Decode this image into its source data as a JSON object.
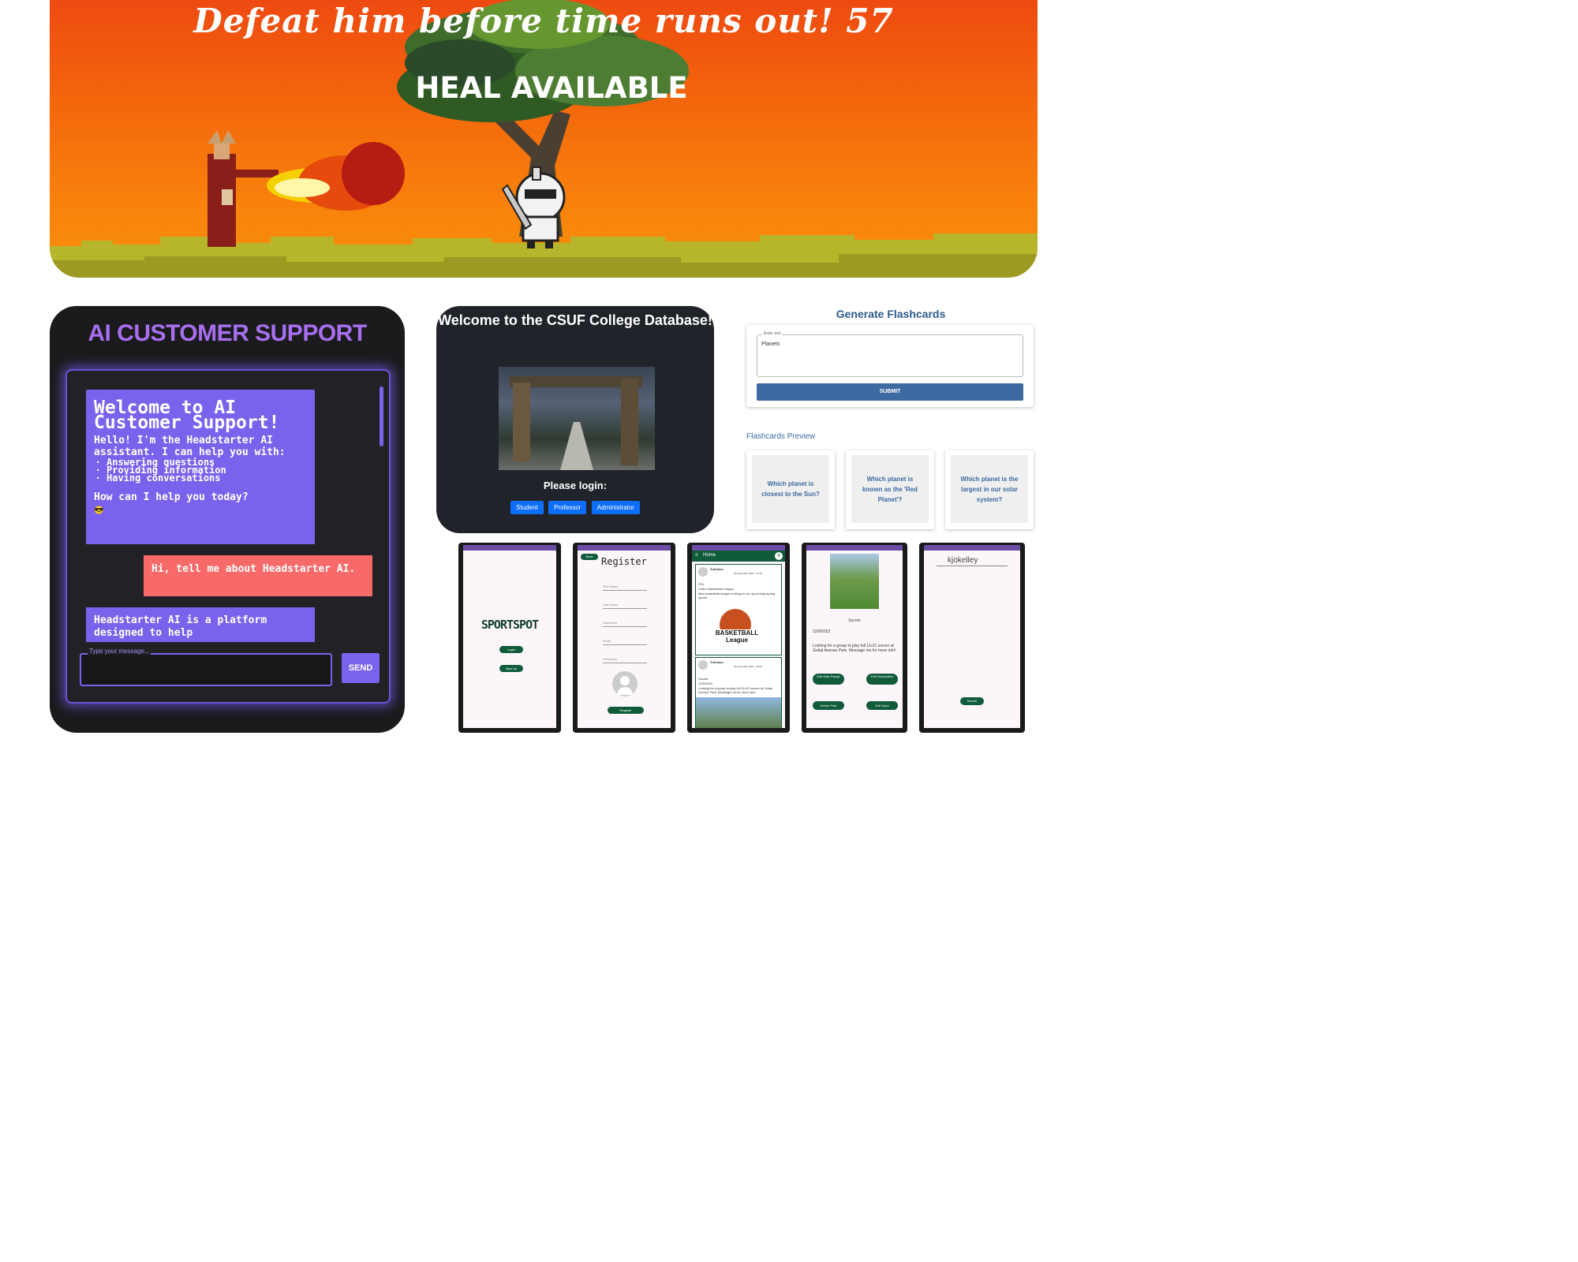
{
  "game": {
    "title": "Defeat him before time runs out! 57",
    "status": "HEAL AVAILABLE"
  },
  "ai_support": {
    "title": "AI CUSTOMER SUPPORT",
    "welcome_heading": "Welcome to AI Customer Support!",
    "welcome_text": "Hello! I'm the Headstarter AI assistant. I can help you with:",
    "capabilities": [
      "Answering questions",
      "Providing information",
      "Having conversations"
    ],
    "welcome_question": "How can I help you today?",
    "welcome_emoji": "😎",
    "user_message": "Hi, tell me about Headstarter AI.",
    "bot_reply": "Headstarter AI is a platform designed to help",
    "input_placeholder": "Type your message...",
    "send_label": "SEND"
  },
  "csuf": {
    "title": "Welcome to the CSUF College Database!",
    "login_prompt": "Please login:",
    "buttons": [
      "Student",
      "Professor",
      "Administrator"
    ]
  },
  "flashcards": {
    "title": "Generate Flashcards",
    "input_label": "Enter text",
    "input_value": "Planets",
    "submit_label": "SUBMIT",
    "preview_label": "Flashcards Preview",
    "cards": [
      "Which planet is closest to the Sun?",
      "Which planet is known as the 'Red Planet'?",
      "Which planet is the largest in our solar system?"
    ]
  },
  "sportspot": {
    "logo": "SPORTSPOT",
    "login": "Login",
    "signup": "Sign Up",
    "back": "Back",
    "register_title": "Register",
    "register_fields": [
      "First Name",
      "Last Name",
      "Username",
      "Email",
      "Password"
    ],
    "register_button": "Register",
    "home_title": "Home",
    "post1_user": "Zohhaos",
    "post1_date": "22 December 2023 · 17:15",
    "post1_sport": "CSL",
    "post1_title": "Club's Basketball League",
    "post1_text": "New basketball league looking for an up-coming spring sports",
    "basketball_logo": "BASKETBALL League",
    "post2_user": "Zohhaos",
    "post2_date": "24 December 2023 · 20:23",
    "post2_sport": "Soccer",
    "post2_date_text": "12/9/2023",
    "post2_text": "Looking for a group to play full 11v11 soccer at Gobal Avenue Park. Message me for more info!",
    "detail_sport": "Soccer",
    "detail_date": "12/9/2023",
    "detail_text": "Looking for a group to play full 11v11 soccer at Gobal Avenue Park. Message me for more info!",
    "detail_buttons": [
      "Edit Date Range",
      "Edit Description",
      "Delete Post",
      "Edit Sport"
    ],
    "search_value": "kjokelley",
    "search_button": "Search"
  },
  "colors": {
    "game_orange": "#f4690c",
    "ai_purple": "#7b62ec",
    "ai_red": "#f86a6a",
    "csuf_blue": "#0d6efd",
    "flash_blue": "#3c6aa1",
    "sport_green": "#0f5b3a"
  }
}
